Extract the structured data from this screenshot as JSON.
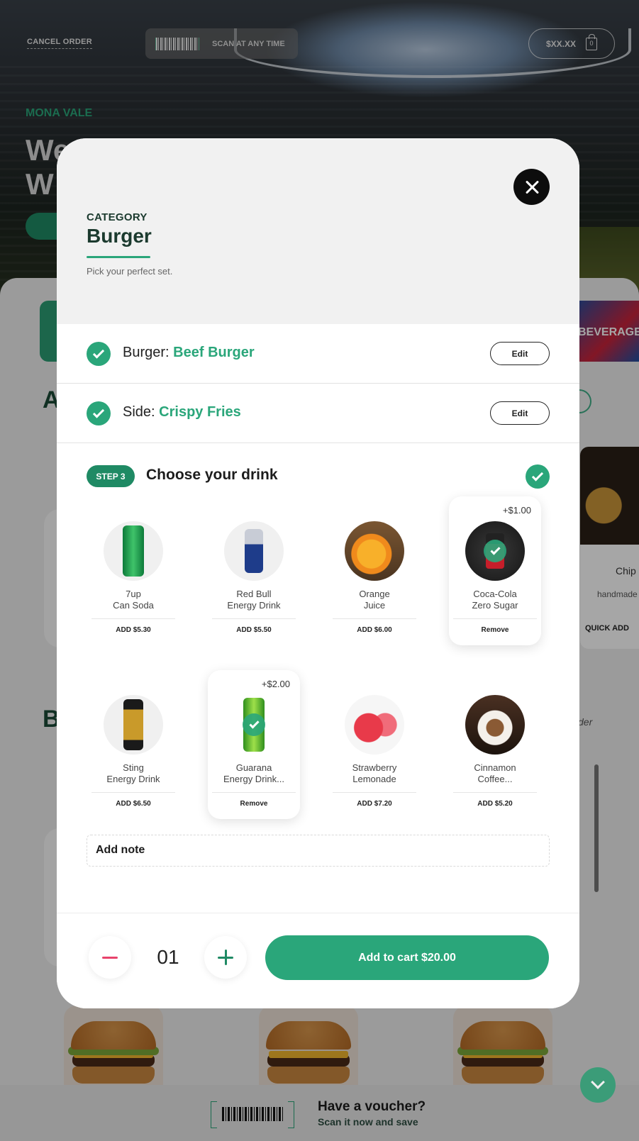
{
  "header": {
    "cancel_label": "CANCEL ORDER",
    "scan_label": "SCAN AT ANY TIME",
    "cart_amount": "$XX.XX",
    "cart_count": "0"
  },
  "hero": {
    "venue": "MONA VALE",
    "title_partial_1": "We",
    "title_partial_2": "W"
  },
  "background": {
    "beverage_tile": "BEVERAGE",
    "section_a_letter": "A",
    "section_b_letter": "B",
    "chips_name": "Chip",
    "chips_desc": "handmade",
    "quick_add": "QUICK ADD",
    "order_hint": "der"
  },
  "modal": {
    "category_label": "CATEGORY",
    "category_title": "Burger",
    "category_sub": "Pick your perfect set.",
    "steps": [
      {
        "label": "Burger:",
        "value": "Beef Burger",
        "edit": "Edit"
      },
      {
        "label": "Side:",
        "value": "Crispy Fries",
        "edit": "Edit"
      }
    ],
    "step3": {
      "badge": "STEP 3",
      "title": "Choose your drink"
    },
    "drinks": [
      {
        "name_1": "7up",
        "name_2": "Can Soda",
        "action": "ADD $5.30",
        "extra": "",
        "selected": false,
        "icon": "7up-can"
      },
      {
        "name_1": "Red Bull",
        "name_2": "Energy Drink",
        "action": "ADD $5.50",
        "extra": "",
        "selected": false,
        "icon": "redbull-can"
      },
      {
        "name_1": "Orange",
        "name_2": "Juice",
        "action": "ADD $6.00",
        "extra": "",
        "selected": false,
        "icon": "orange-juice"
      },
      {
        "name_1": "Coca-Cola",
        "name_2": "Zero Sugar",
        "action": "Remove",
        "extra": "+$1.00",
        "selected": true,
        "icon": "coke-can"
      },
      {
        "name_1": "Sting",
        "name_2": "Energy Drink",
        "action": "ADD $6.50",
        "extra": "",
        "selected": false,
        "icon": "sting-can"
      },
      {
        "name_1": "Guarana",
        "name_2": "Energy Drink...",
        "action": "Remove",
        "extra": "+$2.00",
        "selected": true,
        "icon": "guarana-can"
      },
      {
        "name_1": "Strawberry",
        "name_2": "Lemonade",
        "action": "ADD $7.20",
        "extra": "",
        "selected": false,
        "icon": "strawberry-lemonade"
      },
      {
        "name_1": "Cinnamon",
        "name_2": "Coffee...",
        "action": "ADD $5.20",
        "extra": "",
        "selected": false,
        "icon": "cinnamon-coffee"
      }
    ],
    "note_label": "Add note",
    "quantity": "01",
    "add_to_cart": "Add to cart $20.00"
  },
  "voucher": {
    "title": "Have a voucher?",
    "subtitle": "Scan it now and save"
  },
  "colors": {
    "accent": "#2aa67a",
    "accent_dark": "#1f8a64",
    "minus": "#e8436b"
  }
}
